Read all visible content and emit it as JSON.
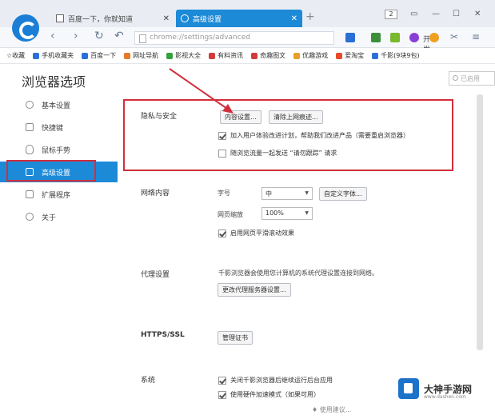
{
  "tabs": [
    {
      "label": "百度一下，你就知道",
      "close": "✕"
    },
    {
      "label": "高级设置",
      "close": "✕"
    }
  ],
  "new_tab": "+",
  "window_controls": {
    "badge": "2",
    "minimize": "—",
    "maximize": "☐",
    "close": "✕"
  },
  "nav": {
    "back": "‹",
    "forward": "›",
    "refresh": "↻",
    "undo": "↶",
    "address": "chrome://settings/advanced",
    "address_suffix": "开发全..."
  },
  "bookmarks": [
    {
      "label": "☆收藏",
      "color": "#f0b400"
    },
    {
      "label": "手机收藏夹",
      "color": "#2a6fd6"
    },
    {
      "label": "百度一下",
      "color": "#2a6fd6"
    },
    {
      "label": "网址导航",
      "color": "#e8782a"
    },
    {
      "label": "影视大全",
      "color": "#35a040"
    },
    {
      "label": "有料资讯",
      "color": "#d23c3c"
    },
    {
      "label": "奇趣图文",
      "color": "#d23c3c"
    },
    {
      "label": "优趣游戏",
      "color": "#e8a02a"
    },
    {
      "label": "爱淘宝",
      "color": "#e84a2a"
    },
    {
      "label": "千影(9块9包)",
      "color": "#2a6fd6"
    }
  ],
  "page_title": "浏览器选项",
  "search_placeholder": "已启用",
  "sidebar": {
    "items": [
      {
        "label": "基本设置"
      },
      {
        "label": "快捷键"
      },
      {
        "label": "鼠标手势"
      },
      {
        "label": "高级设置"
      },
      {
        "label": "扩展程序"
      },
      {
        "label": "关于"
      }
    ]
  },
  "privacy": {
    "title": "隐私与安全",
    "content_settings": "内容设置...",
    "clear_data": "清除上网痕迹...",
    "improve_plan": "加入用户体验改进计划，帮助我们改进产品（需要重启浏览器）",
    "do_not_track": "随浏览流量一起发送 “请勿跟踪” 请求"
  },
  "web_content": {
    "title": "网络内容",
    "font_label": "字号",
    "font_value": "中",
    "custom_font": "自定义字体...",
    "zoom_label": "网页缩放",
    "zoom_value": "100%",
    "smooth_scroll": "启用网页平滑滚动效果"
  },
  "proxy": {
    "title": "代理设置",
    "description": "千影浏览器会使用您计算机的系统代理设置连接到网络。",
    "change": "更改代理服务器设置..."
  },
  "https": {
    "title": "HTTPS/SSL",
    "manage": "管理证书"
  },
  "system": {
    "title": "系统",
    "bg_run": "关闭千影浏览器后继续运行后台应用",
    "hw_accel": "使用硬件加速模式（如果可用）"
  },
  "brand": {
    "name": "大神手游网",
    "url": "www.dashen.com"
  },
  "footer": "♦ 使用建议...",
  "colors": {
    "accent": "#1d8ad8",
    "highlight": "#d22e3c"
  }
}
